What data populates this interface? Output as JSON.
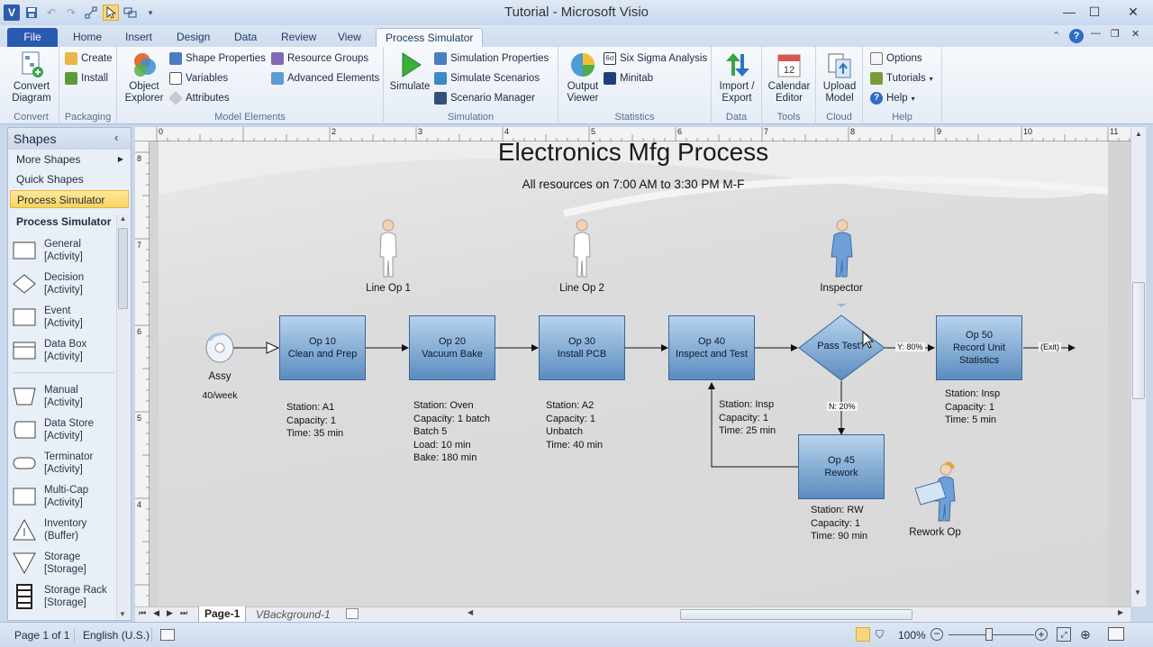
{
  "window": {
    "title": "Tutorial  -  Microsoft Visio",
    "minimize": "—",
    "maximize": "☐",
    "close": "✕"
  },
  "tabs": [
    "File",
    "Home",
    "Insert",
    "Design",
    "Data",
    "Review",
    "View",
    "Process Simulator"
  ],
  "ribbon": {
    "convert": {
      "button": "Convert Diagram",
      "label": "Convert"
    },
    "packaging": {
      "create": "Create",
      "install": "Install",
      "label": "Packaging"
    },
    "model": {
      "object_explorer": "Object Explorer",
      "shape_properties": "Shape Properties",
      "variables": "Variables",
      "attributes": "Attributes",
      "resource_groups": "Resource Groups",
      "advanced_elements": "Advanced Elements",
      "label": "Model Elements"
    },
    "simulation": {
      "simulate": "Simulate",
      "sim_properties": "Simulation Properties",
      "sim_scenarios": "Simulate Scenarios",
      "scenario_manager": "Scenario Manager",
      "label": "Simulation"
    },
    "statistics": {
      "output_viewer": "Output Viewer",
      "six_sigma": "Six Sigma Analysis",
      "minitab": "Minitab",
      "label": "Statistics"
    },
    "data": {
      "import_export": "Import / Export",
      "label": "Data"
    },
    "tools": {
      "calendar": "Calendar Editor",
      "label": "Tools",
      "cal_num": "12"
    },
    "cloud": {
      "upload": "Upload Model",
      "label": "Cloud"
    },
    "help": {
      "options": "Options",
      "tutorials": "Tutorials",
      "help": "Help",
      "label": "Help"
    }
  },
  "shapes_pane": {
    "title": "Shapes",
    "more_shapes": "More Shapes",
    "quick_shapes": "Quick Shapes",
    "process_simulator": "Process Simulator",
    "stencil_title": "Process Simulator",
    "items": [
      {
        "l1": "General",
        "l2": "[Activity]"
      },
      {
        "l1": "Decision",
        "l2": "[Activity]"
      },
      {
        "l1": "Event",
        "l2": "[Activity]"
      },
      {
        "l1": "Data Box",
        "l2": "[Activity]"
      },
      {
        "l1": "Manual",
        "l2": "[Activity]"
      },
      {
        "l1": "Data Store",
        "l2": "[Activity]"
      },
      {
        "l1": "Terminator",
        "l2": "[Activity]"
      },
      {
        "l1": "Multi-Cap",
        "l2": "[Activity]"
      },
      {
        "l1": "Inventory",
        "l2": "(Buffer)"
      },
      {
        "l1": "Storage",
        "l2": "[Storage]"
      },
      {
        "l1": "Storage Rack",
        "l2": "[Storage]"
      }
    ]
  },
  "ruler": {
    "top": [
      "0",
      "1",
      "2",
      "3",
      "4",
      "5",
      "6",
      "7",
      "8",
      "9",
      "10",
      "11"
    ],
    "left": [
      "8",
      "7",
      "6",
      "5",
      "4"
    ]
  },
  "diagram": {
    "title": "Electronics Mfg Process",
    "subtitle": "All resources on 7:00 AM to 3:30 PM M-F",
    "resources": [
      "Line Op 1",
      "Line Op 2",
      "Inspector",
      "Rework Op"
    ],
    "arrival": {
      "name": "Assy",
      "rate": "40/week"
    },
    "ops": [
      {
        "l1": "Op 10",
        "l2": "Clean and Prep"
      },
      {
        "l1": "Op 20",
        "l2": "Vacuum Bake"
      },
      {
        "l1": "Op 30",
        "l2": "Install PCB"
      },
      {
        "l1": "Op 40",
        "l2": "Inspect and Test"
      },
      {
        "l1": "Op 50",
        "l2": "Record Unit",
        "l3": "Statistics"
      },
      {
        "l1": "Op 45",
        "l2": "Rework"
      }
    ],
    "decision": "Pass Test?",
    "yes_label": "Y: 80%",
    "no_label": "N: 20%",
    "exit": "(Exit)",
    "info": {
      "op10": [
        "Station: A1",
        "Capacity: 1",
        "Time: 35 min"
      ],
      "op20": [
        "Station: Oven",
        "Capacity: 1 batch",
        "Batch 5",
        "Load: 10 min",
        "Bake: 180 min"
      ],
      "op30": [
        "Station: A2",
        "Capacity: 1",
        "Unbatch",
        "Time: 40 min"
      ],
      "op40": [
        "Station: Insp",
        "Capacity: 1",
        "Time: 25 min"
      ],
      "op50": [
        "Station: Insp",
        "Capacity: 1",
        "Time: 5 min"
      ],
      "op45": [
        "Station: RW",
        "Capacity: 1",
        "Time: 90 min"
      ]
    }
  },
  "page_tabs": {
    "page1": "Page-1",
    "background": "VBackground-1"
  },
  "status": {
    "page": "Page 1 of 1",
    "language": "English (U.S.)",
    "zoom": "100%"
  }
}
